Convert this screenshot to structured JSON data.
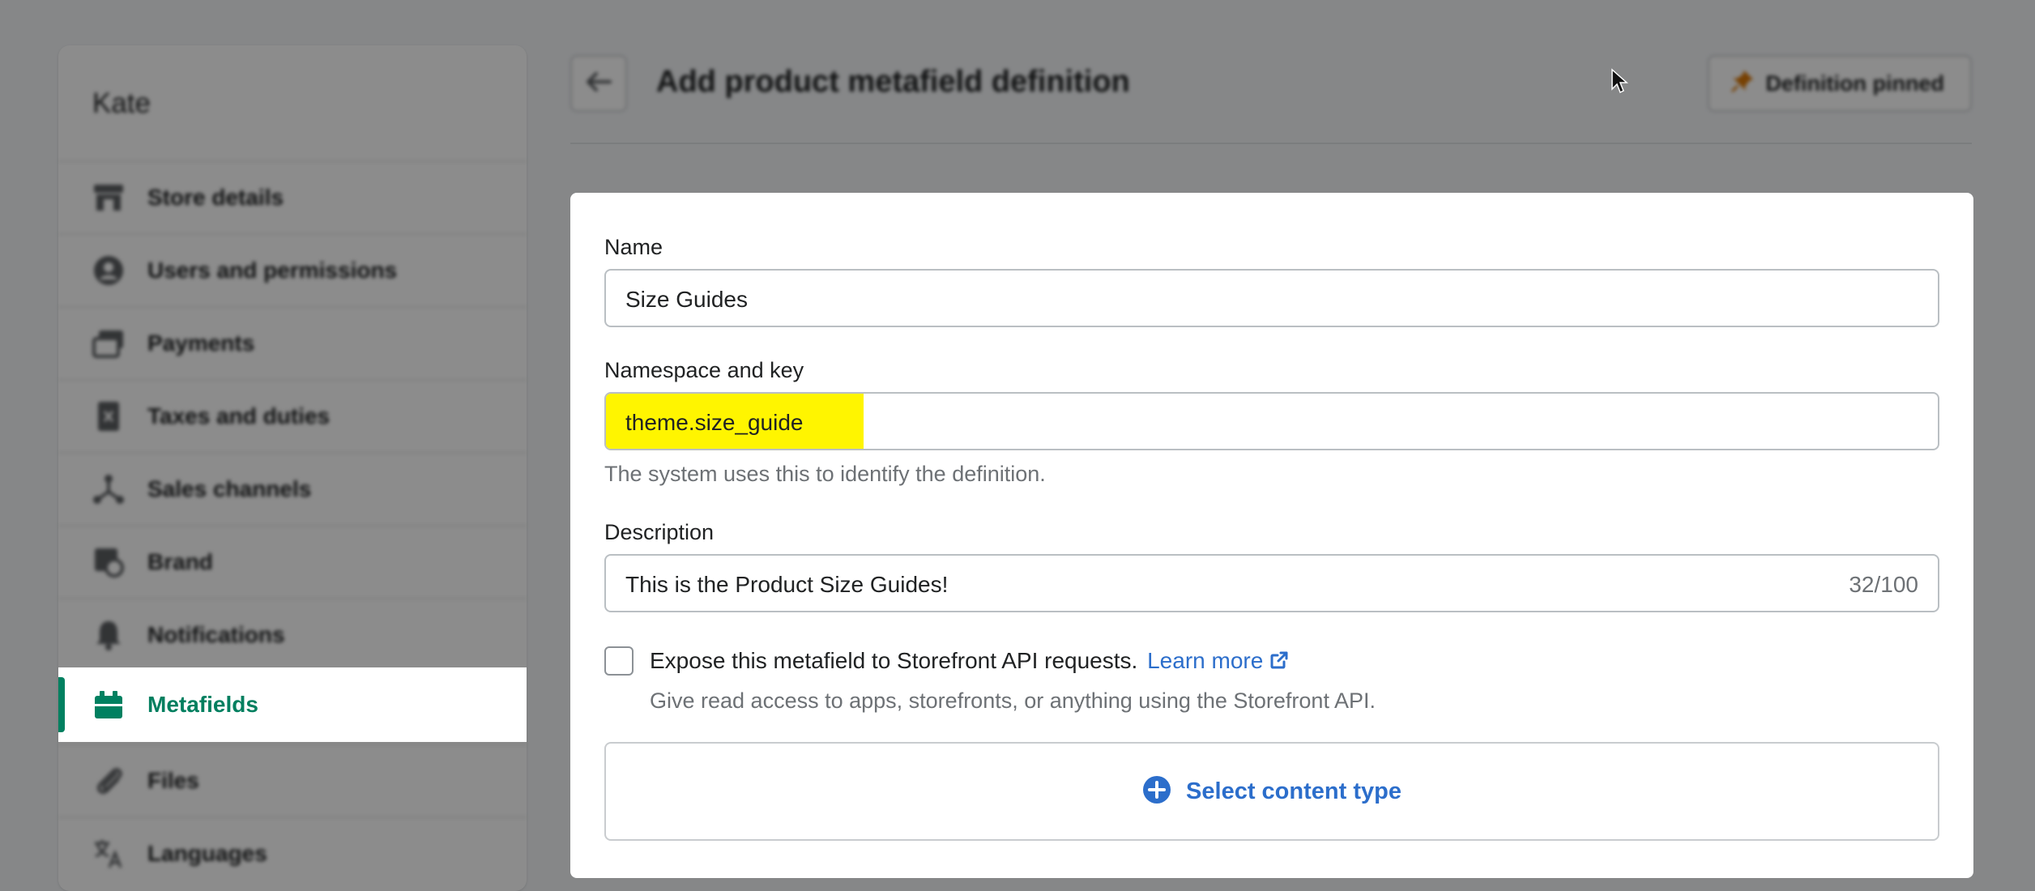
{
  "sidebar": {
    "store_name": "Kate",
    "items": [
      {
        "label": "Store details",
        "icon": "store-icon"
      },
      {
        "label": "Users and permissions",
        "icon": "user-icon"
      },
      {
        "label": "Payments",
        "icon": "payments-icon"
      },
      {
        "label": "Taxes and duties",
        "icon": "tax-icon"
      },
      {
        "label": "Sales channels",
        "icon": "channels-icon"
      },
      {
        "label": "Brand",
        "icon": "brand-icon"
      },
      {
        "label": "Notifications",
        "icon": "bell-icon"
      },
      {
        "label": "Metafields",
        "icon": "metafields-icon",
        "active": true
      },
      {
        "label": "Files",
        "icon": "paperclip-icon"
      },
      {
        "label": "Languages",
        "icon": "translate-icon"
      }
    ]
  },
  "header": {
    "title": "Add product metafield definition",
    "pinned_label": "Definition pinned"
  },
  "form": {
    "name": {
      "label": "Name",
      "value": "Size Guides"
    },
    "namespace": {
      "label": "Namespace and key",
      "value": "theme.size_guide",
      "help": "The system uses this to identify the definition."
    },
    "description": {
      "label": "Description",
      "value": "This is the Product Size Guides!",
      "counter": "32/100"
    },
    "storefront": {
      "checked": false,
      "label": "Expose this metafield to Storefront API requests.",
      "link": "Learn more",
      "help": "Give read access to apps, storefronts, or anything using the Storefront API."
    },
    "content_type": {
      "label": "Select content type"
    }
  },
  "colors": {
    "accent_green": "#008060",
    "link_blue": "#2c6ecb",
    "highlight_yellow": "#fff500"
  }
}
